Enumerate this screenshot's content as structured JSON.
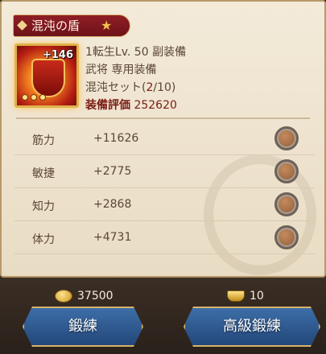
{
  "title": "混沌の盾",
  "item": {
    "plus_level": "+146",
    "line1": "1転生Lv. 50  副装備",
    "line2": "武将  専用装備",
    "set_label": "混沌セット",
    "set_current": "2",
    "set_total": "/10",
    "set_open": "(",
    "set_close": ")",
    "score_label": "装備評価",
    "score_value": "252620"
  },
  "stats": [
    {
      "name": "筋力",
      "value": "+11626"
    },
    {
      "name": "敏捷",
      "value": "+2775"
    },
    {
      "name": "知力",
      "value": "+2868"
    },
    {
      "name": "体力",
      "value": "+4731"
    }
  ],
  "costs": {
    "gold": "37500",
    "ingot": "10"
  },
  "buttons": {
    "forge": "鍛練",
    "advanced_forge": "高級鍛練"
  },
  "colors": {
    "title_bg": "#8f1e25",
    "button_blue": "#2f5a92",
    "accent_gold": "#d7b46a"
  }
}
